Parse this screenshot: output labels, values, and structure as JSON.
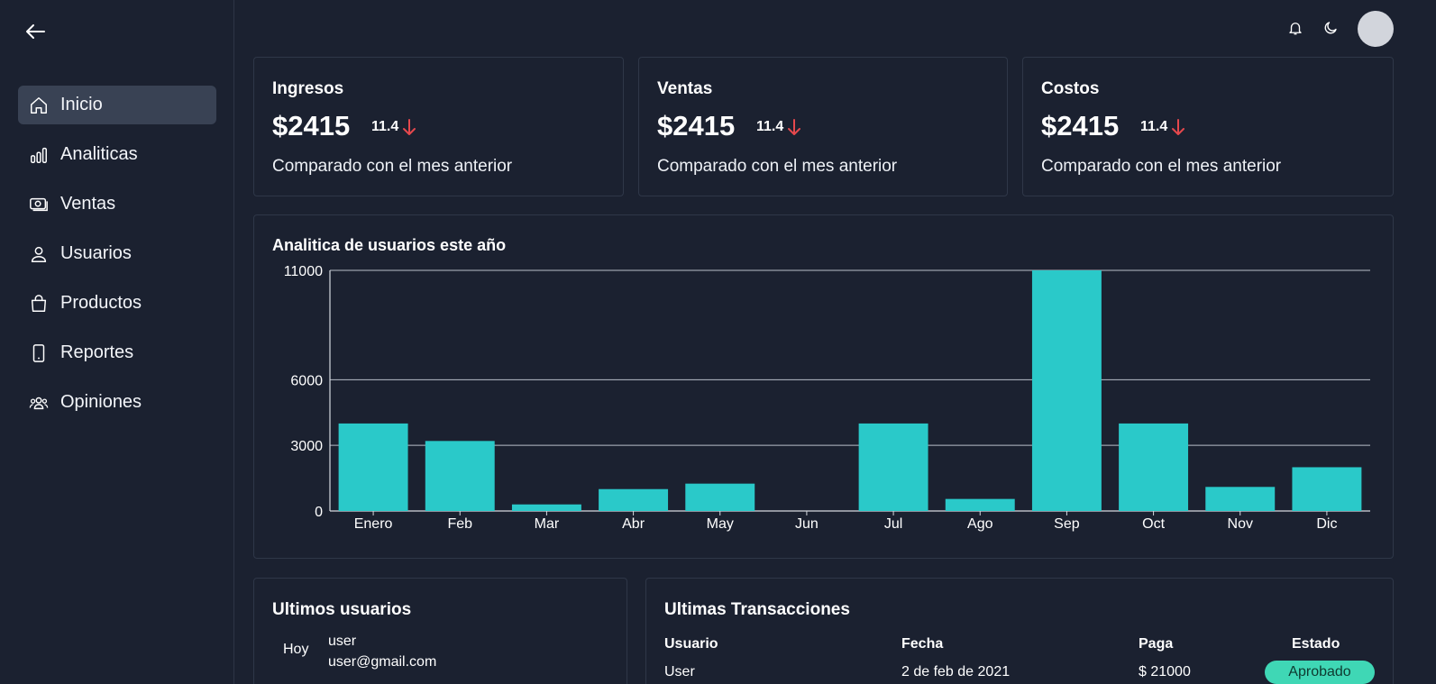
{
  "nav": {
    "items": [
      {
        "label": "Inicio",
        "icon": "home-icon",
        "active": true
      },
      {
        "label": "Analiticas",
        "icon": "bar-chart-icon"
      },
      {
        "label": "Ventas",
        "icon": "money-icon"
      },
      {
        "label": "Usuarios",
        "icon": "user-icon"
      },
      {
        "label": "Productos",
        "icon": "shopping-bag-icon"
      },
      {
        "label": "Reportes",
        "icon": "phone-icon"
      },
      {
        "label": "Opiniones",
        "icon": "users-group-icon"
      }
    ]
  },
  "stats": [
    {
      "title": "Ingresos",
      "value": "$2415",
      "change": "11.4",
      "note": "Comparado con el mes anterior"
    },
    {
      "title": "Ventas",
      "value": "$2415",
      "change": "11.4",
      "note": "Comparado con el mes anterior"
    },
    {
      "title": "Costos",
      "value": "$2415",
      "change": "11.4",
      "note": "Comparado con el mes anterior"
    }
  ],
  "colors": {
    "accent": "#2ac9c9",
    "down": "#e5484d",
    "badge": "#3fd7b5",
    "background": "#1b2130"
  },
  "chart_data": {
    "type": "bar",
    "title": "Analitica de usuarios este año",
    "categories": [
      "Enero",
      "Feb",
      "Mar",
      "Abr",
      "May",
      "Jun",
      "Jul",
      "Ago",
      "Sep",
      "Oct",
      "Nov",
      "Dic"
    ],
    "values": [
      4000,
      3200,
      300,
      1000,
      1250,
      0,
      4000,
      550,
      11000,
      4000,
      1100,
      2000
    ],
    "yticks": [
      0,
      3000,
      6000,
      11000
    ],
    "ylim": [
      0,
      11000
    ],
    "grid": true
  },
  "users": {
    "title": "Ultimos usuarios",
    "rows": [
      {
        "date": "Hoy",
        "name": "user",
        "email": "user@gmail.com"
      }
    ]
  },
  "transactions": {
    "title": "Ultimas Transacciones",
    "headers": {
      "user": "Usuario",
      "date": "Fecha",
      "amount": "Paga",
      "status": "Estado"
    },
    "rows": [
      {
        "user": "User",
        "date": "2 de feb de 2021",
        "amount": "$ 21000",
        "status": "Aprobado"
      }
    ]
  }
}
